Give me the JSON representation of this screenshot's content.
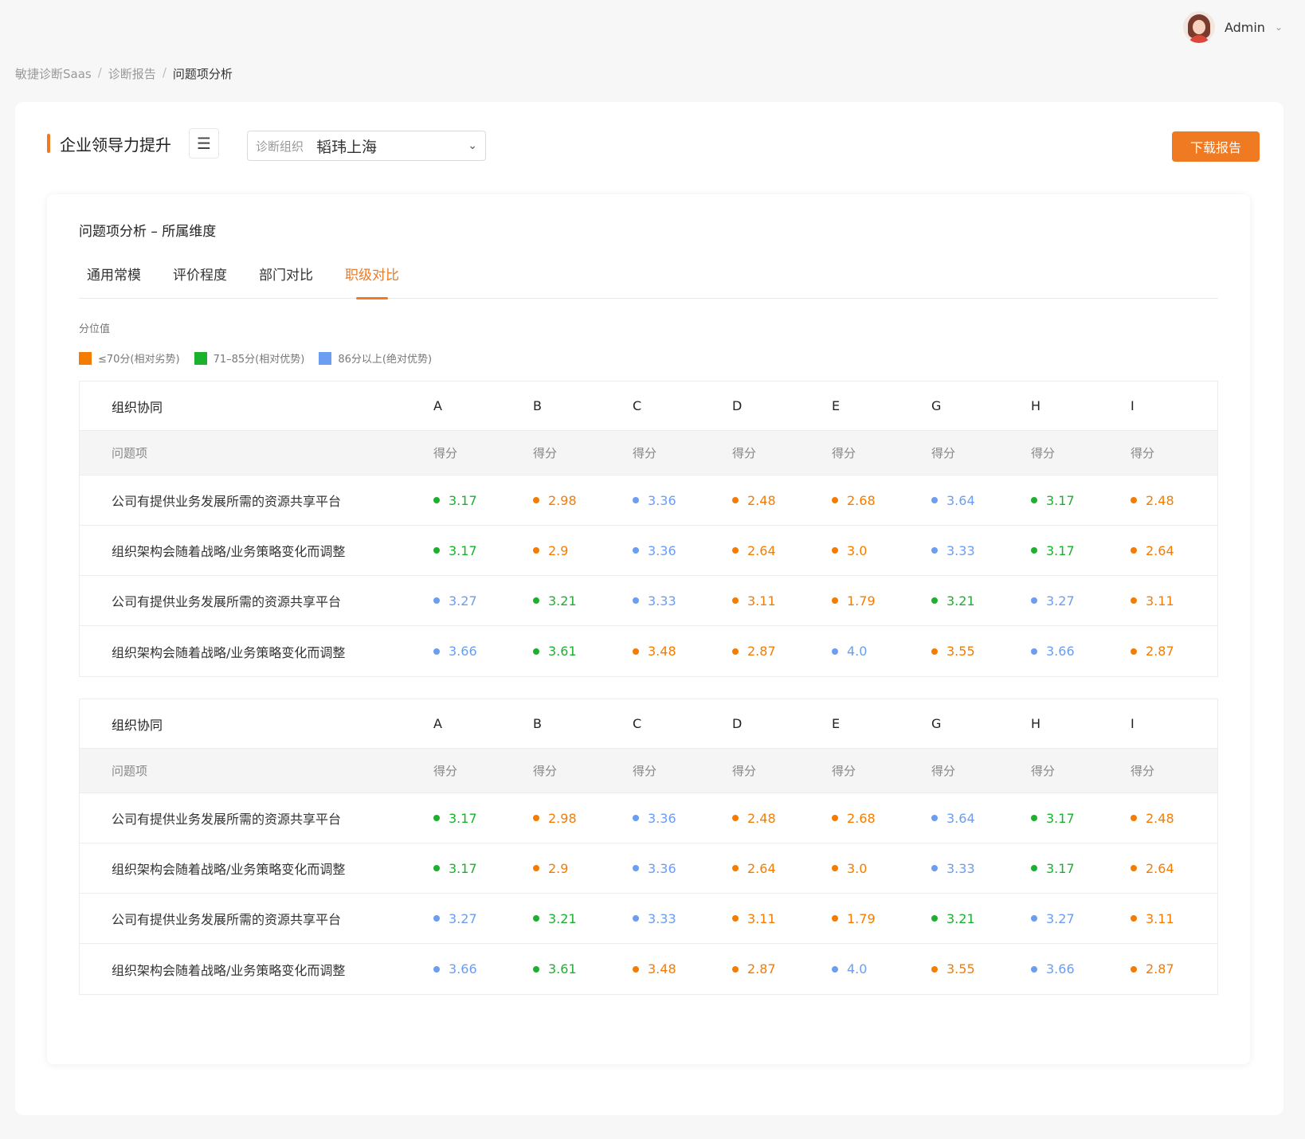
{
  "user": {
    "name": "Admin"
  },
  "breadcrumb": {
    "items": [
      "敏捷诊断Saas",
      "诊断报告",
      "问题项分析"
    ],
    "separator": "/"
  },
  "header": {
    "title": "企业领导力提升",
    "org_label": "诊断组织",
    "org_value": "韬玮上海",
    "download_label": "下载报告"
  },
  "section": {
    "title": "问题项分析 – 所属维度"
  },
  "tabs": [
    {
      "label": "通用常模",
      "active": false
    },
    {
      "label": "评价程度",
      "active": false
    },
    {
      "label": "部门对比",
      "active": false
    },
    {
      "label": "职级对比",
      "active": true
    }
  ],
  "legend": {
    "title": "分位值",
    "items": [
      {
        "label": "≤70分(相对劣势)",
        "color": "#f57c00"
      },
      {
        "label": "71–85分(相对优势)",
        "color": "#1bb12f"
      },
      {
        "label": "86分以上(绝对优势)",
        "color": "#6b9df2"
      }
    ]
  },
  "colors": {
    "orange": "#f57c00",
    "green": "#1bb12f",
    "blue": "#6b9df2",
    "accent": "#ef7a22"
  },
  "tables": [
    {
      "dimension": "组织协同",
      "columns": [
        "A",
        "B",
        "C",
        "D",
        "E",
        "G",
        "H",
        "I"
      ],
      "item_header": "问题项",
      "score_header": "得分",
      "rows": [
        {
          "name": "公司有提供业务发展所需的资源共享平台",
          "scores": [
            {
              "v": "3.17",
              "c": "green"
            },
            {
              "v": "2.98",
              "c": "orange"
            },
            {
              "v": "3.36",
              "c": "blue"
            },
            {
              "v": "2.48",
              "c": "orange"
            },
            {
              "v": "2.68",
              "c": "orange"
            },
            {
              "v": "3.64",
              "c": "blue"
            },
            {
              "v": "3.17",
              "c": "green"
            },
            {
              "v": "2.48",
              "c": "orange"
            }
          ]
        },
        {
          "name": "组织架构会随着战略/业务策略变化而调整",
          "scores": [
            {
              "v": "3.17",
              "c": "green"
            },
            {
              "v": "2.9",
              "c": "orange"
            },
            {
              "v": "3.36",
              "c": "blue"
            },
            {
              "v": "2.64",
              "c": "orange"
            },
            {
              "v": "3.0",
              "c": "orange"
            },
            {
              "v": "3.33",
              "c": "blue"
            },
            {
              "v": "3.17",
              "c": "green"
            },
            {
              "v": "2.64",
              "c": "orange"
            }
          ]
        },
        {
          "name": "公司有提供业务发展所需的资源共享平台",
          "scores": [
            {
              "v": "3.27",
              "c": "blue"
            },
            {
              "v": "3.21",
              "c": "green"
            },
            {
              "v": "3.33",
              "c": "blue"
            },
            {
              "v": "3.11",
              "c": "orange"
            },
            {
              "v": "1.79",
              "c": "orange"
            },
            {
              "v": "3.21",
              "c": "green"
            },
            {
              "v": "3.27",
              "c": "blue"
            },
            {
              "v": "3.11",
              "c": "orange"
            }
          ]
        },
        {
          "name": "组织架构会随着战略/业务策略变化而调整",
          "scores": [
            {
              "v": "3.66",
              "c": "blue"
            },
            {
              "v": "3.61",
              "c": "green"
            },
            {
              "v": "3.48",
              "c": "orange"
            },
            {
              "v": "2.87",
              "c": "orange"
            },
            {
              "v": "4.0",
              "c": "blue"
            },
            {
              "v": "3.55",
              "c": "orange"
            },
            {
              "v": "3.66",
              "c": "blue"
            },
            {
              "v": "2.87",
              "c": "orange"
            }
          ]
        }
      ]
    },
    {
      "dimension": "组织协同",
      "columns": [
        "A",
        "B",
        "C",
        "D",
        "E",
        "G",
        "H",
        "I"
      ],
      "item_header": "问题项",
      "score_header": "得分",
      "rows": [
        {
          "name": "公司有提供业务发展所需的资源共享平台",
          "scores": [
            {
              "v": "3.17",
              "c": "green"
            },
            {
              "v": "2.98",
              "c": "orange"
            },
            {
              "v": "3.36",
              "c": "blue"
            },
            {
              "v": "2.48",
              "c": "orange"
            },
            {
              "v": "2.68",
              "c": "orange"
            },
            {
              "v": "3.64",
              "c": "blue"
            },
            {
              "v": "3.17",
              "c": "green"
            },
            {
              "v": "2.48",
              "c": "orange"
            }
          ]
        },
        {
          "name": "组织架构会随着战略/业务策略变化而调整",
          "scores": [
            {
              "v": "3.17",
              "c": "green"
            },
            {
              "v": "2.9",
              "c": "orange"
            },
            {
              "v": "3.36",
              "c": "blue"
            },
            {
              "v": "2.64",
              "c": "orange"
            },
            {
              "v": "3.0",
              "c": "orange"
            },
            {
              "v": "3.33",
              "c": "blue"
            },
            {
              "v": "3.17",
              "c": "green"
            },
            {
              "v": "2.64",
              "c": "orange"
            }
          ]
        },
        {
          "name": "公司有提供业务发展所需的资源共享平台",
          "scores": [
            {
              "v": "3.27",
              "c": "blue"
            },
            {
              "v": "3.21",
              "c": "green"
            },
            {
              "v": "3.33",
              "c": "blue"
            },
            {
              "v": "3.11",
              "c": "orange"
            },
            {
              "v": "1.79",
              "c": "orange"
            },
            {
              "v": "3.21",
              "c": "green"
            },
            {
              "v": "3.27",
              "c": "blue"
            },
            {
              "v": "3.11",
              "c": "orange"
            }
          ]
        },
        {
          "name": "组织架构会随着战略/业务策略变化而调整",
          "scores": [
            {
              "v": "3.66",
              "c": "blue"
            },
            {
              "v": "3.61",
              "c": "green"
            },
            {
              "v": "3.48",
              "c": "orange"
            },
            {
              "v": "2.87",
              "c": "orange"
            },
            {
              "v": "4.0",
              "c": "blue"
            },
            {
              "v": "3.55",
              "c": "orange"
            },
            {
              "v": "3.66",
              "c": "blue"
            },
            {
              "v": "2.87",
              "c": "orange"
            }
          ]
        }
      ]
    }
  ]
}
